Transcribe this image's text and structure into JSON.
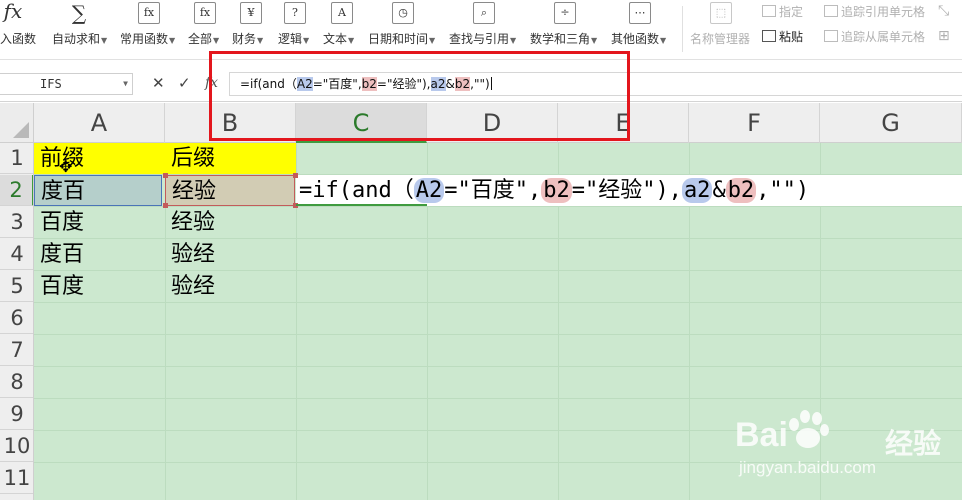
{
  "ribbon": {
    "buttons": [
      {
        "label": "入函数",
        "icon": "fx-icon",
        "glyph": "fx",
        "dropdown": false
      },
      {
        "label": "自动求和",
        "icon": "sum-icon",
        "glyph": "∑",
        "dropdown": true
      },
      {
        "label": "常用函数",
        "icon": "common-functions-icon",
        "glyph": "fx",
        "dropdown": true
      },
      {
        "label": "全部",
        "icon": "all-functions-icon",
        "glyph": "fx",
        "dropdown": true
      },
      {
        "label": "财务",
        "icon": "finance-icon",
        "glyph": "¥",
        "dropdown": true
      },
      {
        "label": "逻辑",
        "icon": "logic-icon",
        "glyph": "?",
        "dropdown": true
      },
      {
        "label": "文本",
        "icon": "text-icon",
        "glyph": "A",
        "dropdown": true
      },
      {
        "label": "日期和时间",
        "icon": "datetime-icon",
        "glyph": "◷",
        "dropdown": true
      },
      {
        "label": "查找与引用",
        "icon": "lookup-icon",
        "glyph": "⌕",
        "dropdown": true
      },
      {
        "label": "数学和三角",
        "icon": "math-icon",
        "glyph": "÷",
        "dropdown": true
      },
      {
        "label": "其他函数",
        "icon": "more-functions-icon",
        "glyph": "⋯",
        "dropdown": true
      },
      {
        "label": "名称管理器",
        "icon": "name-manager-icon",
        "glyph": "⬚",
        "dropdown": false
      }
    ],
    "small": {
      "specify": "指定",
      "paste": "粘贴",
      "trace_precedents": "追踪引用单元格",
      "trace_dependents": "追踪从属单元格"
    }
  },
  "formula_bar": {
    "name_box": "IFS",
    "cancel_symbol": "✕",
    "confirm_symbol": "✓",
    "fx_label": "fx",
    "formula": {
      "p1": "=if(and（",
      "ref1": "A2",
      "p2": "=\"百度\",",
      "ref2": "b2",
      "p3": "=\"经验\"),",
      "ref3": "a2",
      "amp": "&",
      "ref4": "b2",
      "p4": ",\"\")"
    }
  },
  "sheet": {
    "columns": [
      "A",
      "B",
      "C",
      "D",
      "E",
      "F",
      "G"
    ],
    "rows": [
      "1",
      "2",
      "3",
      "4",
      "5",
      "6",
      "7",
      "8",
      "9",
      "10",
      "11"
    ],
    "active_column": "C",
    "active_row": "2",
    "cells": {
      "A1": "前缀",
      "B1": "后缀",
      "A2": "度百",
      "B2": "经验",
      "A3": "百度",
      "B3": "经验",
      "A4": "度百",
      "B4": "验经",
      "A5": "百度",
      "B5": "验经"
    },
    "editing_cell": {
      "p1": "=if(and（",
      "ref1": "A2",
      "p2": "=\"百度\",",
      "ref2": "b2",
      "p3": "=\"经验\"),",
      "ref3": "a2",
      "amp": "&",
      "ref4": "b2",
      "p4": ",\"\")"
    },
    "colors": {
      "grid_background": "#cce8cf",
      "header_fill": "#ffff00",
      "ref_blue": "#b8c9ec",
      "ref_red": "#eebfbf",
      "highlight_box": "#e3161d"
    }
  },
  "watermark": {
    "brand": "Bai",
    "brand2": "经验",
    "url": "jingyan.baidu.com"
  }
}
